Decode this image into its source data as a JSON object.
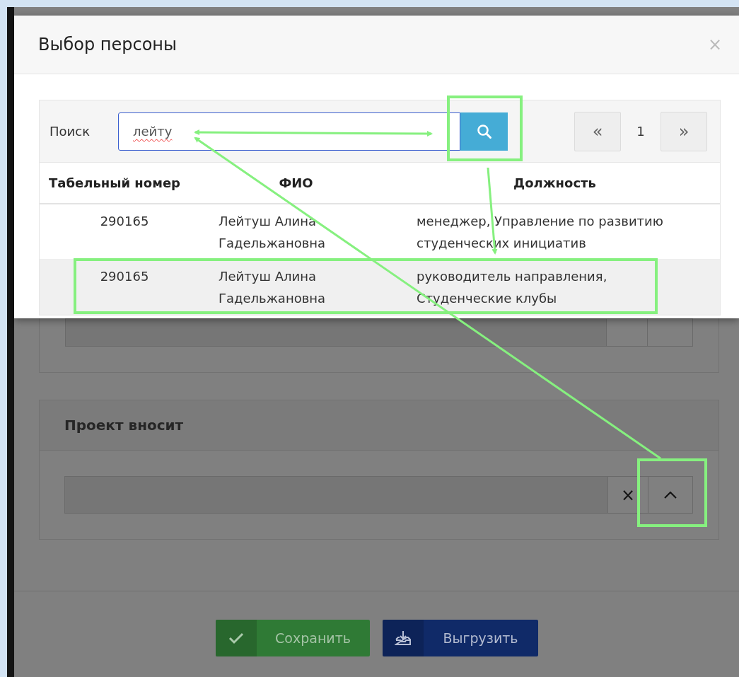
{
  "dialog": {
    "title": "Выбор персоны",
    "close": "×"
  },
  "search": {
    "label": "Поиск",
    "value": "лейту"
  },
  "pager": {
    "prev": "«",
    "page": "1",
    "next": "»"
  },
  "table": {
    "columns": [
      "Табельный номер",
      "ФИО",
      "Должность"
    ],
    "rows": [
      {
        "number": "290165",
        "name": "Лейтуш Алина Гадельжановна",
        "position": "менеджер, Управление по развитию студенческих инициатив",
        "selected": false
      },
      {
        "number": "290165",
        "name": "Лейтуш Алина Гадельжановна",
        "position": "руководитель направления, Студенческие клубы",
        "selected": true
      }
    ]
  },
  "background": {
    "panel_title": "Проект вносит",
    "clear": "×",
    "buttons": [
      {
        "kind": "save",
        "label": "Сохранить"
      },
      {
        "kind": "export",
        "label": "Выгрузить"
      }
    ]
  }
}
